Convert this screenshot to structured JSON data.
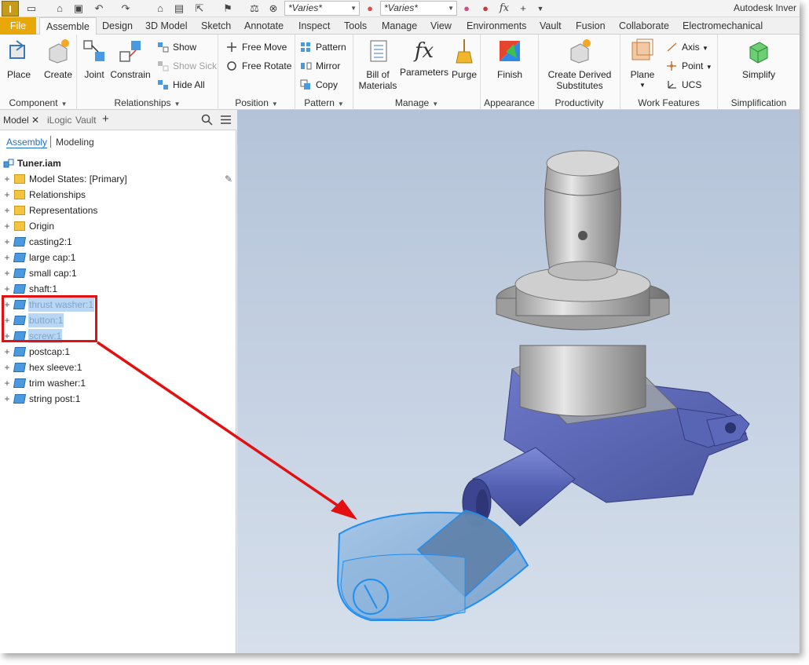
{
  "app": {
    "title": "Autodesk Inver",
    "logo": "I"
  },
  "qat": {
    "combo1": "*Varies*",
    "combo2": "*Varies*"
  },
  "tabs": [
    {
      "label": "File"
    },
    {
      "label": "Assemble"
    },
    {
      "label": "Design"
    },
    {
      "label": "3D Model"
    },
    {
      "label": "Sketch"
    },
    {
      "label": "Annotate"
    },
    {
      "label": "Inspect"
    },
    {
      "label": "Tools"
    },
    {
      "label": "Manage"
    },
    {
      "label": "View"
    },
    {
      "label": "Environments"
    },
    {
      "label": "Vault"
    },
    {
      "label": "Fusion"
    },
    {
      "label": "Collaborate"
    },
    {
      "label": "Electromechanical"
    }
  ],
  "ribbon": {
    "component": {
      "title": "Component",
      "place": "Place",
      "create": "Create"
    },
    "relationships": {
      "title": "Relationships",
      "joint": "Joint",
      "constrain": "Constrain",
      "show": "Show",
      "show_sick": "Show Sick",
      "hide_all": "Hide All"
    },
    "position": {
      "title": "Position",
      "free_move": "Free Move",
      "free_rotate": "Free Rotate"
    },
    "pattern": {
      "title": "Pattern",
      "pattern": "Pattern",
      "mirror": "Mirror",
      "copy": "Copy"
    },
    "manage": {
      "title": "Manage",
      "bom_line1": "Bill of",
      "bom_line2": "Materials",
      "parameters": "Parameters",
      "purge": "Purge"
    },
    "appearance": {
      "title": "Appearance",
      "finish": "Finish"
    },
    "productivity": {
      "title": "Productivity",
      "cds_line1": "Create Derived",
      "cds_line2": "Substitutes"
    },
    "work_features": {
      "title": "Work Features",
      "plane": "Plane",
      "axis": "Axis",
      "point": "Point",
      "ucs": "UCS"
    },
    "simplification": {
      "title": "Simplification",
      "simplify": "Simplify"
    }
  },
  "browser": {
    "tabs": {
      "model": "Model",
      "ilogic": "iLogic",
      "vault": "Vault",
      "add": "+"
    },
    "modes": {
      "assembly": "Assembly",
      "modeling": "Modeling"
    },
    "root": "Tuner.iam",
    "items": [
      {
        "label": "Model States: [Primary]",
        "type": "folder"
      },
      {
        "label": "Relationships",
        "type": "folder"
      },
      {
        "label": "Representations",
        "type": "folder"
      },
      {
        "label": "Origin",
        "type": "folder"
      },
      {
        "label": "casting2:1",
        "type": "part"
      },
      {
        "label": "large cap:1",
        "type": "part"
      },
      {
        "label": "small cap:1",
        "type": "part"
      },
      {
        "label": "shaft:1",
        "type": "part"
      },
      {
        "label": "thrust washer:1",
        "type": "part",
        "selected": true
      },
      {
        "label": "button:1",
        "type": "part",
        "selected": true
      },
      {
        "label": "screw:1",
        "type": "part",
        "selected": true
      },
      {
        "label": "postcap:1",
        "type": "part"
      },
      {
        "label": "hex sleeve:1",
        "type": "part"
      },
      {
        "label": "trim washer:1",
        "type": "part"
      },
      {
        "label": "string post:1",
        "type": "part"
      }
    ]
  },
  "colors": {
    "file_tab": "#e8a80a",
    "selection": "#b9d7f5",
    "annotation": "#e21010",
    "part_highlight": "#4a9ae0"
  }
}
